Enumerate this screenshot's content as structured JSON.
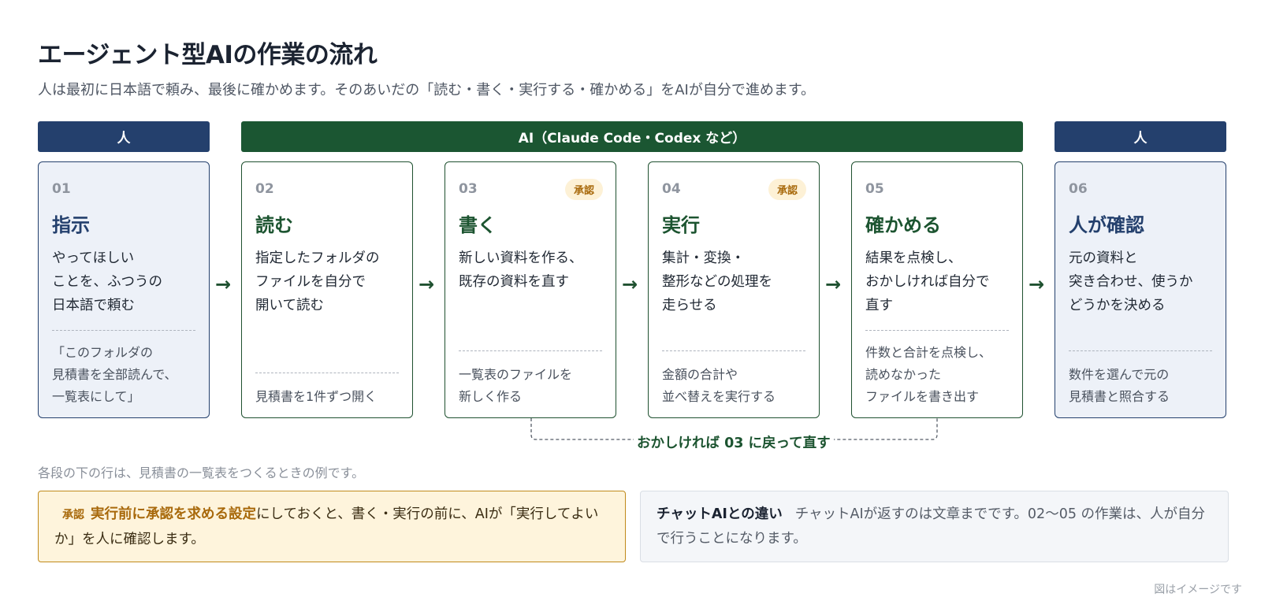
{
  "title": "エージェント型AIの作業の流れ",
  "subtitle": "人は最初に日本語で頼み、最後に確かめます。そのあいだの「読む・書く・実行する・確かめる」をAIが自分で進めます。",
  "bands": {
    "human_left": "人",
    "ai": "AI（Claude Code・Codex など）",
    "human_right": "人"
  },
  "steps": [
    {
      "num": "01",
      "heading": "指示",
      "desc": [
        "やってほしい",
        "ことを、ふつうの",
        "日本語で頼む"
      ],
      "example": [
        "「このフォルダの",
        "見積書を全部読んで、",
        "一覧表にして」"
      ],
      "badge": ""
    },
    {
      "num": "02",
      "heading": "読む",
      "desc": [
        "指定したフォルダの",
        "ファイルを自分で",
        "開いて読む"
      ],
      "example": [
        "見積書を1件ずつ開く"
      ],
      "badge": ""
    },
    {
      "num": "03",
      "heading": "書く",
      "desc": [
        "新しい資料を作る、",
        "既存の資料を直す"
      ],
      "example": [
        "一覧表のファイルを",
        "新しく作る"
      ],
      "badge": "承認"
    },
    {
      "num": "04",
      "heading": "実行",
      "desc": [
        "集計・変換・",
        "整形などの処理を",
        "走らせる"
      ],
      "example": [
        "金額の合計や",
        "並べ替えを実行する"
      ],
      "badge": "承認"
    },
    {
      "num": "05",
      "heading": "確かめる",
      "desc": [
        "結果を点検し、",
        "おかしければ自分で",
        "直す"
      ],
      "example": [
        "件数と合計を点検し、",
        "読めなかった",
        "ファイルを書き出す"
      ],
      "badge": ""
    },
    {
      "num": "06",
      "heading": "人が確認",
      "desc": [
        "元の資料と",
        "突き合わせ、使うか",
        "どうかを決める"
      ],
      "example": [
        "数件を選んで元の",
        "見積書と照合する"
      ],
      "badge": ""
    }
  ],
  "arrow_glyph": "→",
  "loop_label": "おかしければ 03 に戻って直す",
  "note": "各段の下の行は、見積書の一覧表をつくるときの例です。",
  "approval_box": {
    "tag": "承認",
    "highlight": "実行前に承認を求める設定",
    "text": "にしておくと、書く・実行の前に、AIが「実行してよいか」を人に確認します。"
  },
  "chat_box": {
    "title": "チャットAIとの違い",
    "text": "チャットAIが返すのは文章までです。02〜05 の作業は、人が自分で行うことになります。"
  },
  "footer": "図はイメージです",
  "colors": {
    "human": "#24406d",
    "ai": "#1b5632",
    "approval": "#a8690b"
  }
}
